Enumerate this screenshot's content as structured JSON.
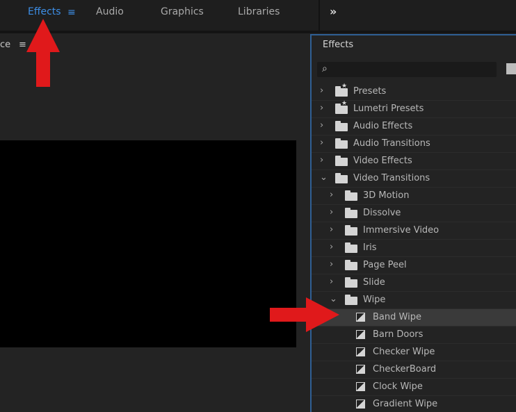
{
  "workspaces": {
    "effects": "Effects",
    "menu_glyph": "≡",
    "audio": "Audio",
    "graphics": "Graphics",
    "libraries": "Libraries",
    "more": "»"
  },
  "source_panel": {
    "tab_label": "ce",
    "menu_glyph": "≡"
  },
  "effects_panel": {
    "title": "Effects",
    "search_placeholder": "",
    "search_icon": "⌕",
    "tree": [
      {
        "label": "Presets",
        "level": 1,
        "expanded": false,
        "icon": "folder-star"
      },
      {
        "label": "Lumetri Presets",
        "level": 1,
        "expanded": false,
        "icon": "folder-star"
      },
      {
        "label": "Audio Effects",
        "level": 1,
        "expanded": false,
        "icon": "folder"
      },
      {
        "label": "Audio Transitions",
        "level": 1,
        "expanded": false,
        "icon": "folder"
      },
      {
        "label": "Video Effects",
        "level": 1,
        "expanded": false,
        "icon": "folder"
      },
      {
        "label": "Video Transitions",
        "level": 1,
        "expanded": true,
        "icon": "folder"
      },
      {
        "label": "3D Motion",
        "level": 2,
        "expanded": false,
        "icon": "folder"
      },
      {
        "label": "Dissolve",
        "level": 2,
        "expanded": false,
        "icon": "folder"
      },
      {
        "label": "Immersive Video",
        "level": 2,
        "expanded": false,
        "icon": "folder"
      },
      {
        "label": "Iris",
        "level": 2,
        "expanded": false,
        "icon": "folder"
      },
      {
        "label": "Page Peel",
        "level": 2,
        "expanded": false,
        "icon": "folder"
      },
      {
        "label": "Slide",
        "level": 2,
        "expanded": false,
        "icon": "folder"
      },
      {
        "label": "Wipe",
        "level": 2,
        "expanded": true,
        "icon": "folder"
      },
      {
        "label": "Band Wipe",
        "level": 3,
        "icon": "transition",
        "selected": true
      },
      {
        "label": "Barn Doors",
        "level": 3,
        "icon": "transition"
      },
      {
        "label": "Checker Wipe",
        "level": 3,
        "icon": "transition"
      },
      {
        "label": "CheckerBoard",
        "level": 3,
        "icon": "transition"
      },
      {
        "label": "Clock Wipe",
        "level": 3,
        "icon": "transition"
      },
      {
        "label": "Gradient Wipe",
        "level": 3,
        "icon": "transition"
      }
    ]
  },
  "colors": {
    "accent": "#3d8ee6",
    "annotation": "#e0191b",
    "panel_border": "#2f5f94"
  }
}
